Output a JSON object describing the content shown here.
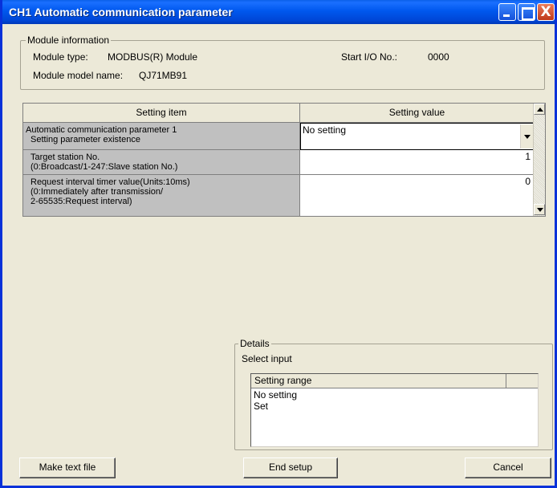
{
  "window": {
    "title": "CH1 Automatic communication parameter",
    "close_glyph": "X"
  },
  "module_info": {
    "legend": "Module information",
    "module_type_label": "Module type:",
    "module_type_value": "MODBUS(R) Module",
    "start_io_label": "Start I/O No.:",
    "start_io_value": "0000",
    "model_name_label": "Module model name:",
    "model_name_value": "QJ71MB91"
  },
  "grid": {
    "headers": [
      "Setting item",
      "Setting value"
    ],
    "rows": [
      {
        "item_line1": "Automatic communication parameter 1",
        "item_line2": "Setting parameter existence",
        "value": "No setting",
        "type": "combo"
      },
      {
        "item_line1": "Target station No.",
        "item_line2": "(0:Broadcast/1-247:Slave station No.)",
        "value": "1",
        "type": "number"
      },
      {
        "item_line1": "Request interval timer value(Units:10ms)",
        "item_line2": "(0:Immediately after transmission/",
        "item_line3": "2-65535:Request interval)",
        "value": "0",
        "type": "number"
      }
    ]
  },
  "details": {
    "legend": "Details",
    "select_input": "Select input",
    "range_header": "Setting range",
    "options": [
      "No setting",
      "Set"
    ]
  },
  "buttons": {
    "make_text_file": "Make text file",
    "end_setup": "End setup",
    "cancel": "Cancel"
  },
  "icons": {
    "minimize": "minimize-icon",
    "maximize": "maximize-icon",
    "close": "close-icon",
    "dropdown": "chevron-down-icon",
    "scroll_up": "scroll-up-arrow-icon",
    "scroll_down": "scroll-down-arrow-icon"
  },
  "colors": {
    "titlebar": "#0058ee",
    "window_bg": "#ece9d8",
    "item_cell_bg": "#c0c0c0",
    "close_button": "#c0391b"
  }
}
